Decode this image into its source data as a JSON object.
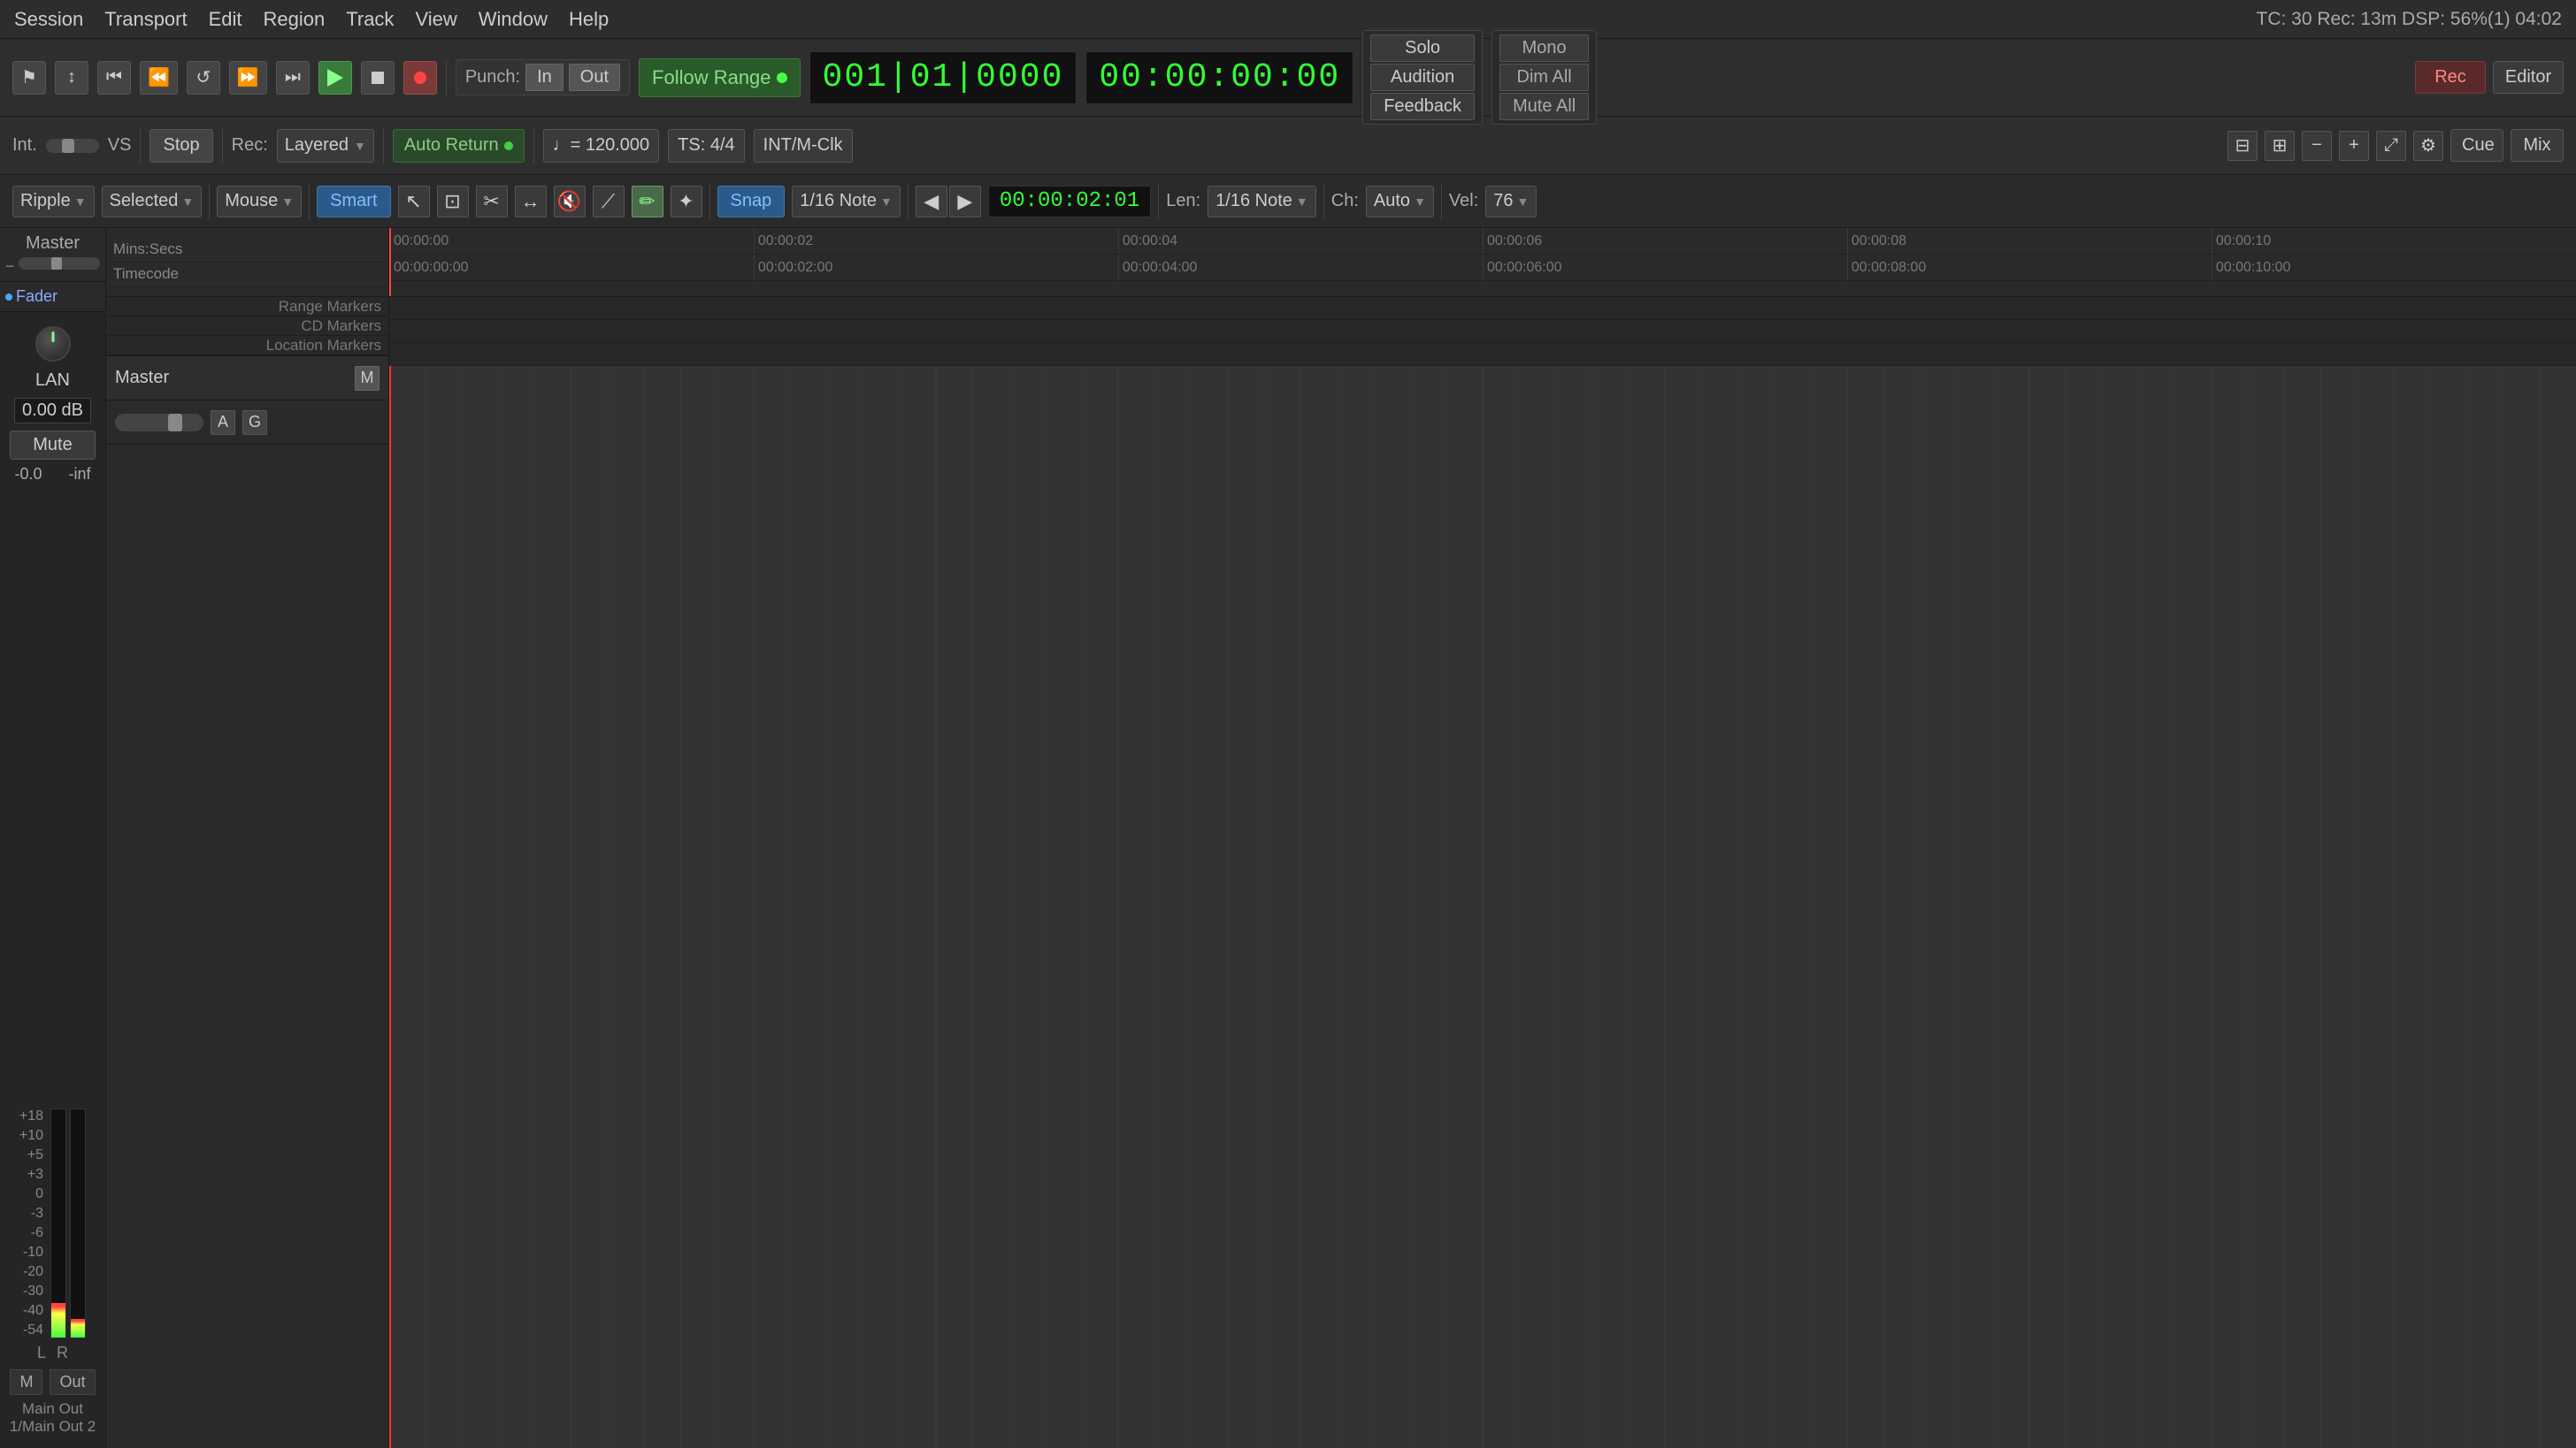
{
  "menubar": {
    "items": [
      "Session",
      "Transport",
      "Edit",
      "Region",
      "Track",
      "View",
      "Window",
      "Help"
    ],
    "tc_info": "TC: 30   Rec: 13m   DSP: 56%(1)   04:02"
  },
  "transport": {
    "punch_label": "Punch:",
    "punch_in": "In",
    "punch_out": "Out",
    "follow_range": "Follow Range",
    "timecode": "001|01|0000",
    "time": "00:00:00:00",
    "solo": "Solo",
    "audition": "Audition",
    "feedback": "Feedback",
    "mono": "Mono",
    "dim_all": "Dim All",
    "mute_all": "Mute All"
  },
  "transport2": {
    "int_label": "Int.",
    "vs_label": "VS",
    "stop_label": "Stop",
    "rec_label": "Rec:",
    "rec_mode": "Layered",
    "auto_return": "Auto Return",
    "tempo": "♩= 120.000",
    "ts": "TS: 4/4",
    "clk": "INT/M-Clk"
  },
  "toolbar": {
    "ripple": "Ripple",
    "selected": "Selected",
    "mouse": "Mouse",
    "smart": "Smart",
    "snap": "Snap",
    "grid": "1/16 Note",
    "position": "00:00:02:01",
    "len_label": "Len:",
    "len": "1/16 Note",
    "ch_label": "Ch:",
    "ch": "Auto",
    "vel_label": "Vel:",
    "vel": "76"
  },
  "ruler": {
    "mins_secs_label": "Mins:Secs",
    "timecode_label": "Timecode",
    "ticks_mins": [
      "00:00:00",
      "00:00:02",
      "00:00:04",
      "00:00:06",
      "00:00:08",
      "00:00:10"
    ],
    "ticks_tc": [
      "00:00:00:00",
      "00:00:02:00",
      "00:00:04:00",
      "00:00:06:00",
      "00:00:08:00",
      "00:00:10:00"
    ]
  },
  "markers": {
    "range_label": "Range Markers",
    "cd_label": "CD Markers",
    "location_label": "Location Markers"
  },
  "master_track": {
    "name": "Master",
    "m_btn": "M",
    "a_btn": "A",
    "g_btn": "G"
  },
  "mixer": {
    "master_label": "Master",
    "fader_label": "Fader",
    "lan_label": "LAN",
    "db_value": "0.00 dB",
    "mute_label": "Mute",
    "l_value": "-0.0",
    "r_value": "-inf",
    "output_label": "Main Out 1/Main Out 2",
    "m_label": "M",
    "out_label": "Out",
    "meter_labels": [
      "+18",
      "+10",
      "+5",
      "+3",
      "0",
      "-3",
      "-6",
      "-10",
      "-20",
      "-30",
      "-40",
      "-54"
    ]
  },
  "top_right": {
    "rec_label": "Rec",
    "mix_label": "Mix",
    "cue_label": "Cue",
    "editor_label": "Editor"
  },
  "zoom": {
    "minus": "−",
    "plus": "+"
  }
}
